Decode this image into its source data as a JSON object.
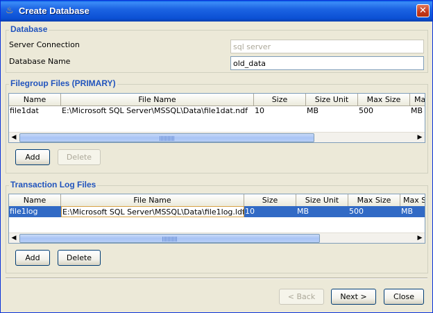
{
  "window": {
    "title": "Create Database",
    "close_glyph": "✕"
  },
  "database": {
    "section_title": "Database",
    "server_connection_label": "Server Connection",
    "server_connection_value": "sql server",
    "database_name_label": "Database Name",
    "database_name_value": "old_data"
  },
  "filegroup": {
    "section_title": "Filegroup Files (PRIMARY)",
    "columns": [
      "Name",
      "File Name",
      "Size",
      "Size Unit",
      "Max Size",
      "Max"
    ],
    "rows": [
      [
        "file1dat",
        "E:\\Microsoft SQL Server\\MSSQL\\Data\\file1dat.ndf",
        "10",
        "MB",
        "500",
        "MB"
      ]
    ],
    "add_label": "Add",
    "delete_label": "Delete"
  },
  "logfiles": {
    "section_title": "Transaction Log Files",
    "columns": [
      "Name",
      "File Name",
      "Size",
      "Size Unit",
      "Max Size",
      "Max Si"
    ],
    "rows": [
      [
        "file1log",
        "E:\\Microsoft SQL Server\\MSSQL\\Data\\file1log.ldf",
        "10",
        "MB",
        "500",
        "MB"
      ]
    ],
    "add_label": "Add",
    "delete_label": "Delete"
  },
  "footer": {
    "back_label": "< Back",
    "next_label": "Next >",
    "close_label": "Close"
  },
  "icons": {
    "app_icon": "java-coffee-icon",
    "scroll_left": "◀",
    "scroll_right": "▶"
  },
  "colors": {
    "title_blue": "#0b50d4",
    "section_title": "#2154bd",
    "selection": "#316ac5"
  }
}
